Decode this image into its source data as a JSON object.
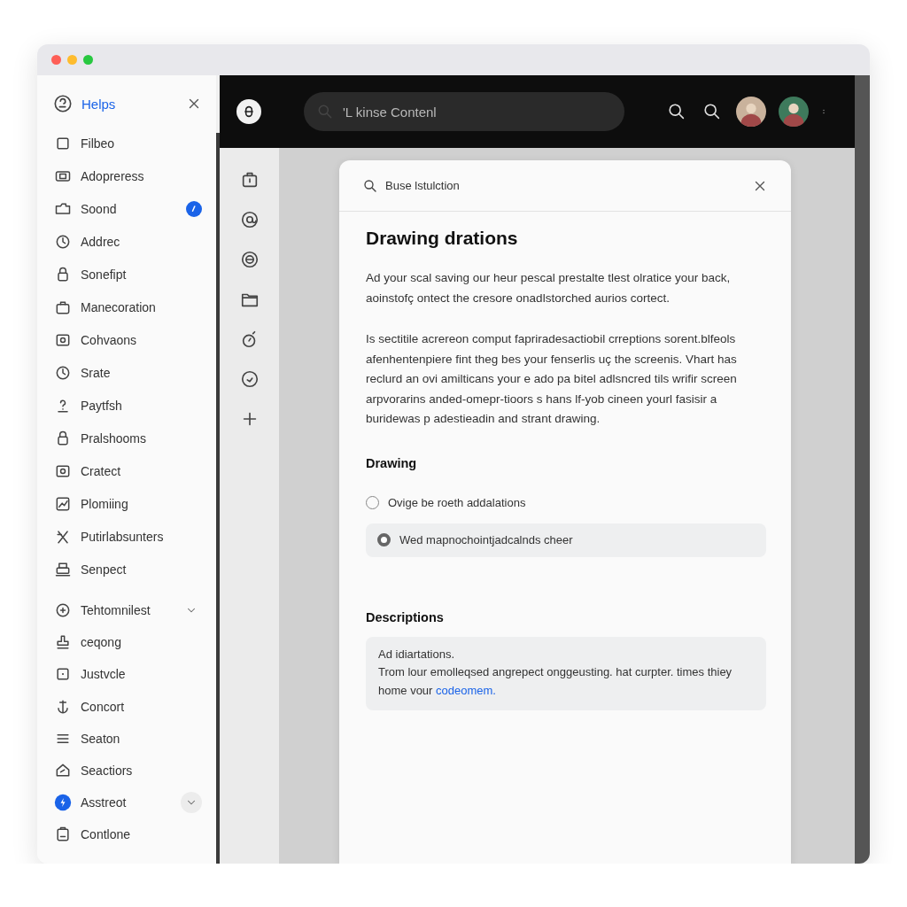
{
  "sidebar": {
    "title": "Helps",
    "groups": [
      {
        "items": [
          {
            "label": "Filbeo",
            "notification": false,
            "expandable": false,
            "highlighted": false
          },
          {
            "label": "Adopreress",
            "notification": false,
            "expandable": false,
            "highlighted": false
          },
          {
            "label": "Soond",
            "notification": true,
            "expandable": false,
            "highlighted": false
          },
          {
            "label": "Addrec",
            "notification": false,
            "expandable": false,
            "highlighted": false
          },
          {
            "label": "Sonefipt",
            "notification": false,
            "expandable": false,
            "highlighted": false
          },
          {
            "label": "Manecoration",
            "notification": false,
            "expandable": false,
            "highlighted": false
          },
          {
            "label": "Cohvaons",
            "notification": false,
            "expandable": false,
            "highlighted": false
          },
          {
            "label": "Srate",
            "notification": false,
            "expandable": false,
            "highlighted": false
          },
          {
            "label": "Paytfsh",
            "notification": false,
            "expandable": false,
            "highlighted": false
          },
          {
            "label": "Pralshooms",
            "notification": false,
            "expandable": false,
            "highlighted": false
          },
          {
            "label": "Cratect",
            "notification": false,
            "expandable": false,
            "highlighted": false
          },
          {
            "label": "Plomiing",
            "notification": false,
            "expandable": false,
            "highlighted": false
          },
          {
            "label": "Putirlabsunters",
            "notification": false,
            "expandable": false,
            "highlighted": false
          },
          {
            "label": "Senpect",
            "notification": false,
            "expandable": false,
            "highlighted": false
          }
        ]
      },
      {
        "items": [
          {
            "label": "Tehtomnilest",
            "notification": false,
            "expandable": true,
            "highlighted": false
          },
          {
            "label": "ceqong",
            "notification": false,
            "expandable": false,
            "highlighted": false
          },
          {
            "label": "Justvcle",
            "notification": false,
            "expandable": false,
            "highlighted": false
          },
          {
            "label": "Concort",
            "notification": false,
            "expandable": false,
            "highlighted": false
          },
          {
            "label": "Seaton",
            "notification": false,
            "expandable": false,
            "highlighted": false
          },
          {
            "label": "Seactiors",
            "notification": false,
            "expandable": false,
            "highlighted": false
          },
          {
            "label": "Asstreot",
            "notification": false,
            "expandable": true,
            "highlighted": true
          },
          {
            "label": "Contlone",
            "notification": false,
            "expandable": false,
            "highlighted": false
          }
        ]
      }
    ]
  },
  "header": {
    "search": {
      "placeholder": "'L kinse Contenl"
    }
  },
  "dialog": {
    "search": {
      "placeholder": "Buse lstulction"
    },
    "title": "Drawing drations",
    "paragraphs": [
      "Ad your scal saving our heur pescal prestalte tlest olratice your back, aoinstofç ontect the cresore onadlstorched aurios cortect.",
      "Is sectitile acrereon comput fapriradesactiobil crreptions sorent.blfeols afenhentenpiere fint theg bes your fenserlis uç the screenis. Vhart has reclurd an ovi amilticans your e ado pa bitel adlsncred tils wrifir screen arpvorarins anded-omepr-tioors s hans lf-yob cineen yourl fasisir a buridewas p adestieadin and strant drawing."
    ],
    "options_heading": "Drawing",
    "options": [
      {
        "label": "Ovige be roeth addalations",
        "selected": false
      },
      {
        "label": "Wed mapnochointjadcalnds cheer",
        "selected": true
      }
    ],
    "descriptions_heading": "Descriptions",
    "description": {
      "first_line": "Ad idiartations.",
      "text": "Trom lour emolleqsed angrepect onggeusting. hat curpter. times thiey home vour",
      "link": "codeomem."
    }
  }
}
